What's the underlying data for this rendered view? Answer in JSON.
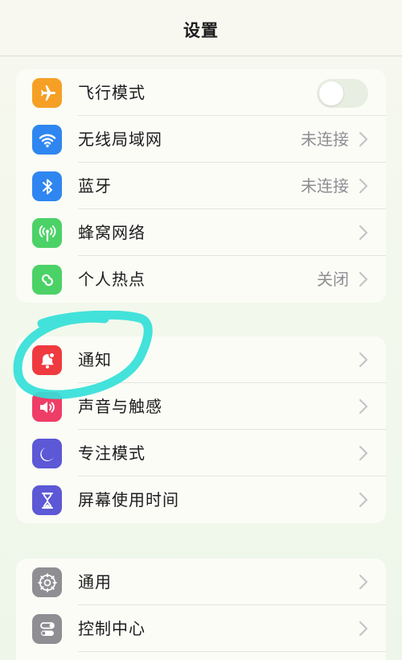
{
  "header": {
    "title": "设置"
  },
  "groups": [
    {
      "items": [
        {
          "label": "飞行模式",
          "icon": "airplane-icon",
          "color": "#f5a025",
          "control": "toggle",
          "toggle_on": false
        },
        {
          "label": "无线局域网",
          "icon": "wifi-icon",
          "color": "#2f86f0",
          "value": "未连接"
        },
        {
          "label": "蓝牙",
          "icon": "bluetooth-icon",
          "color": "#2f86f0",
          "value": "未连接"
        },
        {
          "label": "蜂窝网络",
          "icon": "cellular-antenna-icon",
          "color": "#4bd266"
        },
        {
          "label": "个人热点",
          "icon": "hotspot-link-icon",
          "color": "#4bd266",
          "value": "关闭"
        }
      ]
    },
    {
      "items": [
        {
          "label": "通知",
          "icon": "bell-notification-icon",
          "color": "#ef3b3f"
        },
        {
          "label": "声音与触感",
          "icon": "speaker-icon",
          "color": "#ee3d67"
        },
        {
          "label": "专注模式",
          "icon": "moon-icon",
          "color": "#5c58d6"
        },
        {
          "label": "屏幕使用时间",
          "icon": "hourglass-icon",
          "color": "#5c58d6"
        }
      ]
    },
    {
      "items": [
        {
          "label": "通用",
          "icon": "gear-icon",
          "color": "#8e8e93"
        },
        {
          "label": "控制中心",
          "icon": "control-center-icon",
          "color": "#8e8e93"
        }
      ]
    }
  ],
  "annotation": {
    "kind": "hand-drawn-circle",
    "color": "#33e0d8",
    "target": "通知"
  }
}
